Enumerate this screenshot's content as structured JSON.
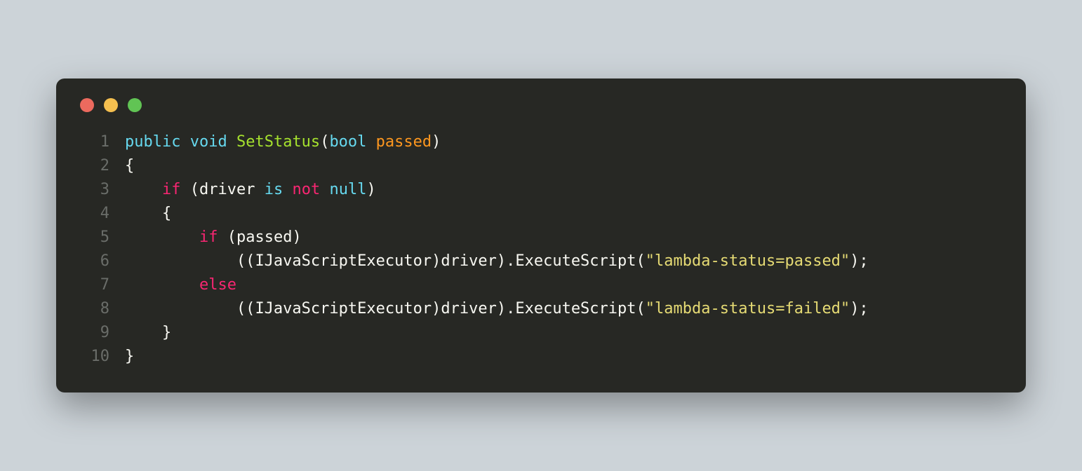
{
  "window": {
    "dots": {
      "red": "#ec6a5e",
      "yellow": "#f4bf4f",
      "green": "#61c454"
    }
  },
  "code": {
    "lines": [
      {
        "n": "1",
        "tokens": [
          [
            "kw",
            "public"
          ],
          [
            "punct",
            " "
          ],
          [
            "kw",
            "void"
          ],
          [
            "punct",
            " "
          ],
          [
            "fn",
            "SetStatus"
          ],
          [
            "punct",
            "("
          ],
          [
            "kw",
            "bool"
          ],
          [
            "punct",
            " "
          ],
          [
            "param",
            "passed"
          ],
          [
            "punct",
            ")"
          ]
        ]
      },
      {
        "n": "2",
        "tokens": [
          [
            "punct",
            "{"
          ]
        ]
      },
      {
        "n": "3",
        "tokens": [
          [
            "punct",
            "    "
          ],
          [
            "kw2",
            "if"
          ],
          [
            "punct",
            " ("
          ],
          [
            "ident",
            "driver"
          ],
          [
            "punct",
            " "
          ],
          [
            "kw",
            "is"
          ],
          [
            "punct",
            " "
          ],
          [
            "kw2",
            "not"
          ],
          [
            "punct",
            " "
          ],
          [
            "kw",
            "null"
          ],
          [
            "punct",
            ")"
          ]
        ]
      },
      {
        "n": "4",
        "tokens": [
          [
            "punct",
            "    {"
          ]
        ]
      },
      {
        "n": "5",
        "tokens": [
          [
            "punct",
            "        "
          ],
          [
            "kw2",
            "if"
          ],
          [
            "punct",
            " ("
          ],
          [
            "ident",
            "passed"
          ],
          [
            "punct",
            ")"
          ]
        ]
      },
      {
        "n": "6",
        "tokens": [
          [
            "punct",
            "            (("
          ],
          [
            "ident",
            "IJavaScriptExecutor"
          ],
          [
            "punct",
            ")"
          ],
          [
            "ident",
            "driver"
          ],
          [
            "punct",
            ")."
          ],
          [
            "ident",
            "ExecuteScript"
          ],
          [
            "punct",
            "("
          ],
          [
            "str",
            "\"lambda-status=passed\""
          ],
          [
            "punct",
            ");"
          ]
        ]
      },
      {
        "n": "7",
        "tokens": [
          [
            "punct",
            "        "
          ],
          [
            "kw2",
            "else"
          ]
        ]
      },
      {
        "n": "8",
        "tokens": [
          [
            "punct",
            "            (("
          ],
          [
            "ident",
            "IJavaScriptExecutor"
          ],
          [
            "punct",
            ")"
          ],
          [
            "ident",
            "driver"
          ],
          [
            "punct",
            ")."
          ],
          [
            "ident",
            "ExecuteScript"
          ],
          [
            "punct",
            "("
          ],
          [
            "str",
            "\"lambda-status=failed\""
          ],
          [
            "punct",
            ");"
          ]
        ]
      },
      {
        "n": "9",
        "tokens": [
          [
            "punct",
            "    }"
          ]
        ]
      },
      {
        "n": "10",
        "tokens": [
          [
            "punct",
            "}"
          ]
        ]
      }
    ]
  }
}
